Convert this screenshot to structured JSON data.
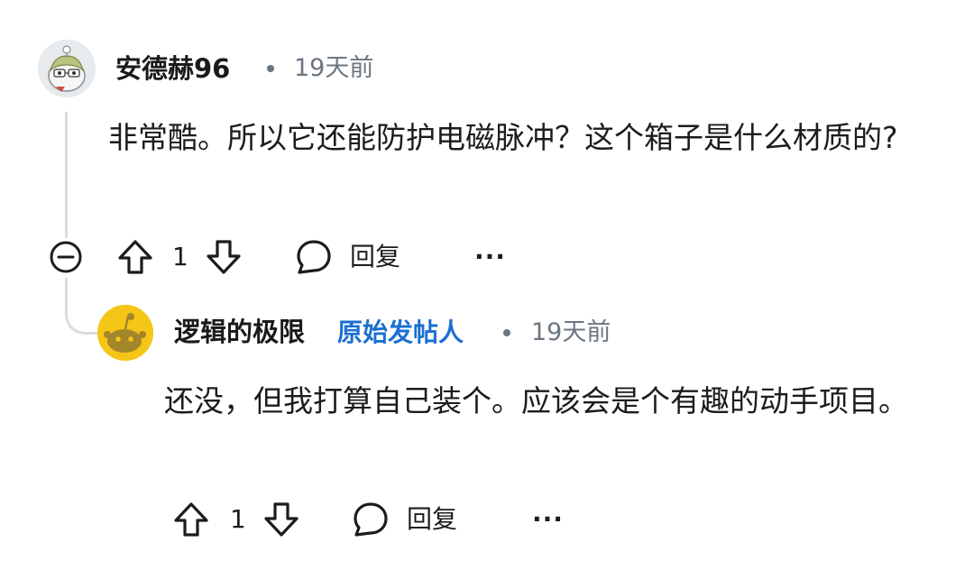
{
  "comment": {
    "author": "安德赫96",
    "time": "19天前",
    "text": "非常酷。所以它还能防护电磁脉冲？这个箱子是什么材质的?",
    "votes": "1",
    "reply_label": "回复",
    "more_label": "···"
  },
  "reply": {
    "author": "逻辑的极限",
    "op_badge": "原始发帖人",
    "time": "19天前",
    "text": "还没，但我打算自己装个。应该会是个有趣的动手项目。",
    "votes": "1",
    "reply_label": "回复",
    "more_label": "···"
  },
  "colors": {
    "op_badge": "#1b6fd0",
    "reply_avatar_bg": "#f5c518",
    "thread_line": "#d9dde0"
  },
  "icons": {
    "collapse": "collapse-minus-icon",
    "upvote": "upvote-arrow-icon",
    "downvote": "downvote-arrow-icon",
    "reply": "comment-bubble-icon",
    "more": "more-dots-icon"
  }
}
